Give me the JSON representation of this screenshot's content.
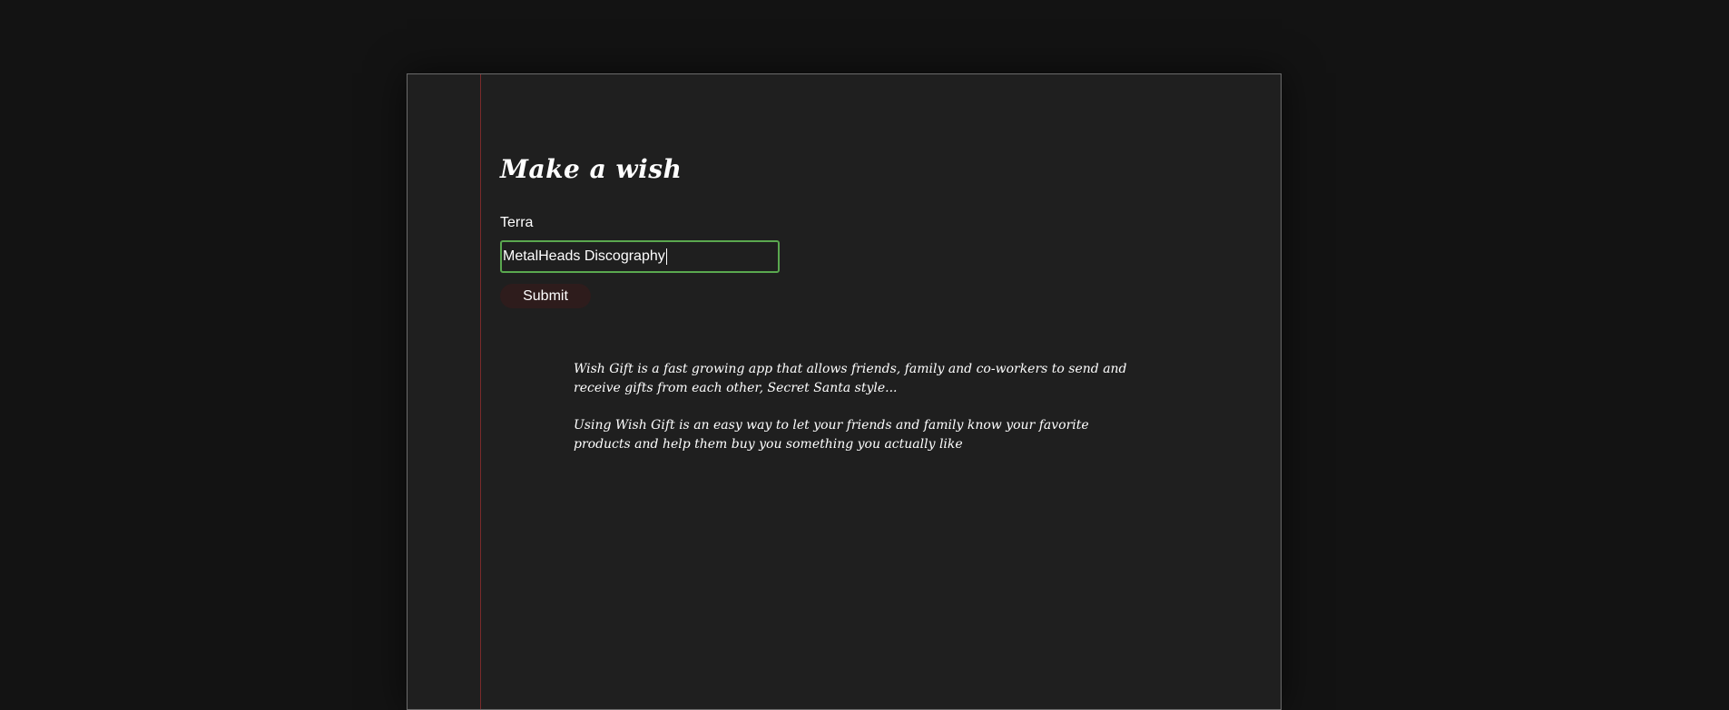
{
  "page": {
    "title": "Make a wish"
  },
  "form": {
    "name_label": "Terra",
    "wish_value": "MetalHeads Discography",
    "submit_label": "Submit",
    "focus_border_color": "#5aa84f"
  },
  "about": {
    "paragraph_1": "Wish Gift is a fast growing app that allows friends, family and co-workers to send and receive gifts from each other, Secret Santa style...",
    "paragraph_2": "Using Wish Gift is an easy way to let your friends and family know your favorite products and help them buy you something you actually like"
  },
  "colors": {
    "background": "#131313",
    "sheet": "#1f1f1f",
    "margin_line": "#7a2a2a",
    "button": "#2e1c1c"
  }
}
